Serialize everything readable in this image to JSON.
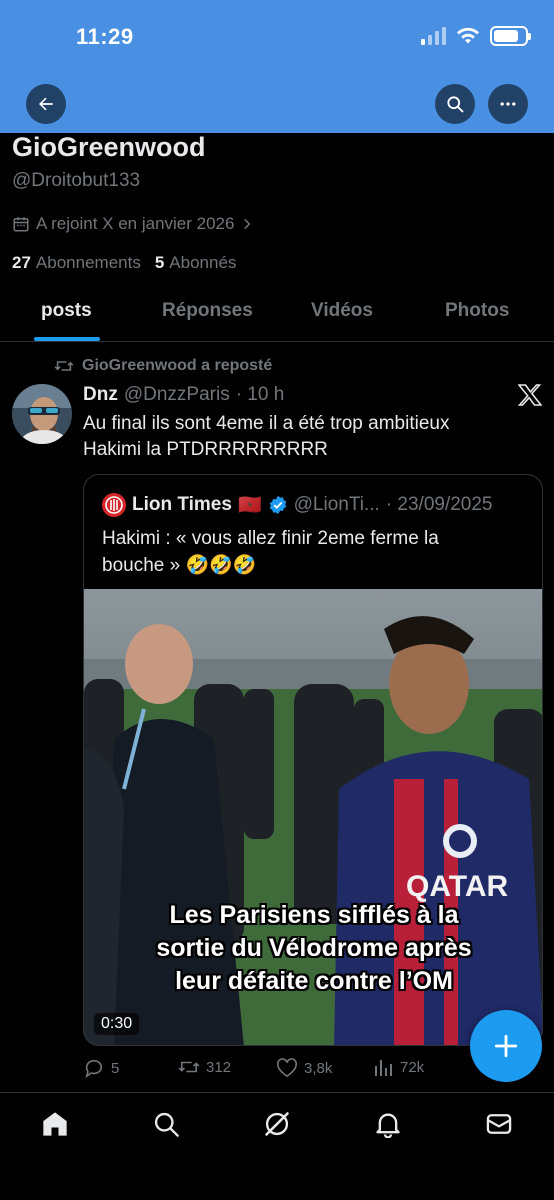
{
  "status_bar": {
    "time": "11:29"
  },
  "profile": {
    "display_name": "GioGreenwood",
    "handle": "@Droitobut133",
    "joined": "A rejoint X en janvier 2026",
    "following_count": "27",
    "following_label": "Abonnements",
    "followers_count": "5",
    "followers_label": "Abonnés"
  },
  "tabs": [
    {
      "label": "posts",
      "active": true
    },
    {
      "label": "Réponses",
      "active": false
    },
    {
      "label": "Vidéos",
      "active": false
    },
    {
      "label": "Photos",
      "active": false
    }
  ],
  "post": {
    "repost_label": "GioGreenwood a reposté",
    "author_name": "Dnz",
    "author_handle": "@DnzzParis",
    "time": "· 10 h",
    "text_line1": "Au final ils sont 4eme il a été trop ambitieux",
    "text_line2": "Hakimi la PTDRRRRRRRRR",
    "quote": {
      "author_name": "Lion Times",
      "flag": "🇲🇦",
      "author_handle": "@LionTi...",
      "date": "· 23/09/2025",
      "text_line1": "Hakimi : « vous allez finir 2eme ferme la",
      "text_line2": "bouche » 🤣🤣🤣",
      "video_caption_line1": "Les Parisiens sifflés à la",
      "video_caption_line2": "sortie du Vélodrome après",
      "video_caption_line3": "leur défaite contre l’OM",
      "duration": "0:30",
      "jersey_text": "QATAR"
    },
    "stats": {
      "replies": "5",
      "reposts": "312",
      "likes": "3,8k",
      "views": "72k"
    }
  },
  "colors": {
    "banner": "#4a90e2",
    "accent": "#1d9bf0",
    "muted": "#71767b",
    "text": "#e7e9ea",
    "verified": "#1d9bf0"
  },
  "icons": [
    "back-arrow-icon",
    "search-icon",
    "more-icon",
    "calendar-icon",
    "chevron-right-icon",
    "repost-icon",
    "x-logo-icon",
    "verified-icon",
    "reply-icon",
    "like-icon",
    "views-icon",
    "plus-icon",
    "home-icon",
    "grok-icon",
    "bell-icon",
    "mail-icon"
  ]
}
